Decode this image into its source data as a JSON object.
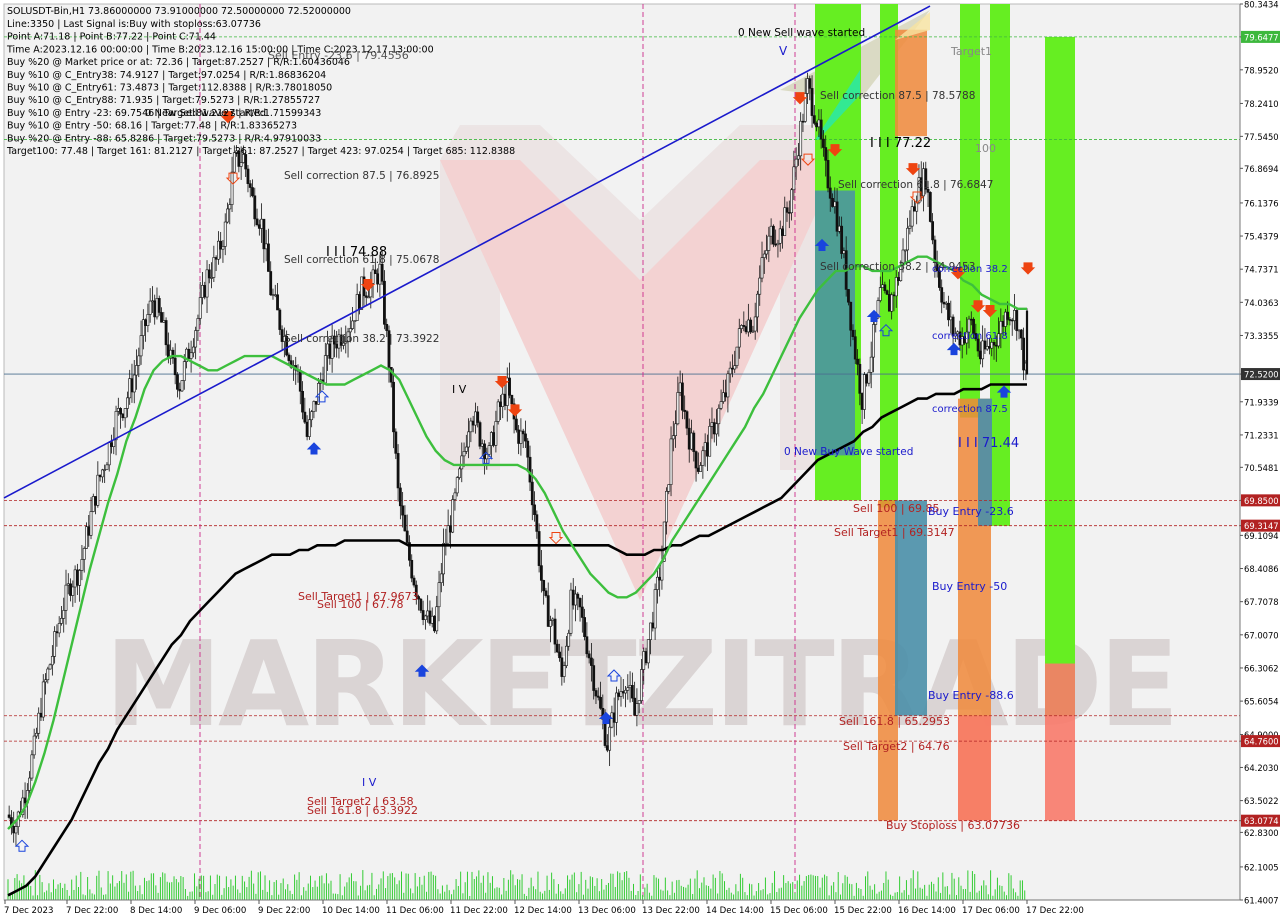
{
  "header": {
    "symbol_line": "SOLUSDT-Bin,H1  73.86000000 73.91000000 72.50000000 72.52000000",
    "lines": [
      "Line:3350 | Last Signal is:Buy with stoploss:63.07736",
      "Point A:71.18 | Point B:77.22 | Point C:71.44",
      "Time A:2023.12.16 00:00:00 | Time B:2023.12.16 15:00:00 | Time C:2023.12.17 13:00:00",
      "Buy %20 @ Market price or at: 72.36 | Target:87.2527 | R/R:1.60436046",
      "Buy %10 @ C_Entry38: 74.9127 | Target:97.0254 | R/R:1.86836204",
      "Buy %10 @ C_Entry61: 73.4873 | Target:112.8388 | R/R:3.78018050",
      "Buy %10 @ C_Entry88: 71.935 | Target:79.5273 | R/R:1.27855727",
      "Buy %10 @ Entry -23: 69.7546 | Target:81.2127 | R/R:1.71599343",
      "Buy %10 @ Entry -50: 68.16 | Target:77.48 | R/R:1.83365273",
      "Buy %20 @ Entry -88: 65.8286 | Target:79.5273 | R/R:4.97910033",
      "Target100: 77.48 | Target 161: 81.2127 | Target 261: 87.2527 | Target 423: 97.0254 | Target 685: 112.8388"
    ]
  },
  "watermark": "MARKETZITRADE",
  "colors": {
    "bull": "#1a1a1a",
    "bear": "#1a1a1a",
    "ma_fast": "#3dbf3d",
    "ma_slow": "#000000",
    "trendline": "#1a1acc",
    "green_level": "#3db83d",
    "red_level": "#b22222",
    "current_price_line": "#4a6f8f",
    "zone_green": "#66ee22",
    "zone_orange": "#f0883a",
    "zone_blue": "#4a8fa8",
    "zone_salmon": "#f87a6a"
  },
  "chart_data": {
    "type": "candlestick",
    "symbol": "SOLUSDT-Bin",
    "timeframe": "H1",
    "ylim": [
      61.4007,
      80.3434
    ],
    "y_ticks": [
      "80.3434",
      "79.6477",
      "78.9520",
      "78.2410",
      "77.5450",
      "76.8694",
      "76.1376",
      "75.4379",
      "74.7371",
      "74.0363",
      "73.3355",
      "72.5200",
      "71.9339",
      "71.2331",
      "70.5481",
      "69.8500",
      "69.3147",
      "69.1094",
      "68.4086",
      "67.7078",
      "67.0070",
      "66.3062",
      "65.6054",
      "64.9000",
      "64.7600",
      "64.2030",
      "63.5022",
      "63.0774",
      "62.8300",
      "62.1005",
      "61.4007"
    ],
    "y_ticks_highlighted": [
      {
        "value": "79.6477",
        "kind": "green"
      },
      {
        "value": "77.4800",
        "kind": "green"
      },
      {
        "value": "72.5200",
        "kind": "current"
      },
      {
        "value": "69.8500",
        "kind": "red"
      },
      {
        "value": "69.3147",
        "kind": "red"
      },
      {
        "value": "65.2953",
        "kind": "red"
      },
      {
        "value": "64.7600",
        "kind": "red"
      },
      {
        "value": "63.0774",
        "kind": "red"
      }
    ],
    "x_tick_labels": [
      "7 Dec 2023",
      "7 Dec 22:00",
      "8 Dec 14:00",
      "9 Dec 06:00",
      "9 Dec 22:00",
      "10 Dec 14:00",
      "11 Dec 06:00",
      "11 Dec 22:00",
      "12 Dec 14:00",
      "13 Dec 06:00",
      "13 Dec 22:00",
      "14 Dec 14:00",
      "15 Dec 06:00",
      "15 Dec 22:00",
      "16 Dec 14:00",
      "17 Dec 06:00",
      "17 Dec 22:00"
    ],
    "current_price": 72.52,
    "last_bar": {
      "open": 73.86,
      "high": 73.91,
      "low": 72.5,
      "close": 72.52
    },
    "anchor_closes": [
      63.2,
      63.0,
      63.7,
      64.6,
      65.8,
      66.6,
      67.5,
      68.1,
      68.4,
      69.3,
      70.2,
      70.8,
      71.6,
      71.9,
      72.5,
      73.4,
      74.1,
      73.6,
      72.8,
      72.3,
      73.0,
      73.7,
      74.6,
      74.9,
      75.6,
      77.0,
      77.1,
      76.2,
      75.7,
      74.3,
      73.6,
      73.0,
      72.5,
      71.2,
      72.0,
      72.8,
      73.2,
      73.4,
      73.7,
      74.3,
      74.4,
      74.7,
      72.8,
      70.0,
      68.8,
      68.0,
      67.4,
      67.1,
      68.8,
      69.6,
      70.6,
      71.8,
      71.2,
      70.8,
      71.7,
      72.2,
      71.3,
      71.1,
      69.6,
      67.7,
      67.2,
      66.1,
      67.7,
      67.5,
      66.6,
      65.6,
      64.7,
      65.6,
      66.1,
      65.3,
      66.4,
      67.4,
      68.6,
      71.0,
      72.2,
      71.2,
      70.6,
      71.0,
      71.6,
      72.1,
      72.9,
      73.7,
      73.6,
      74.8,
      75.5,
      75.5,
      76.1,
      77.4,
      78.6,
      77.9,
      76.8,
      76.1,
      74.9,
      73.3,
      72.0,
      73.0,
      74.2,
      74.0,
      74.6,
      75.5,
      76.4,
      76.7,
      75.0,
      74.0,
      73.4,
      73.3,
      73.6,
      72.9,
      73.1,
      73.4,
      73.9,
      73.7,
      72.52
    ],
    "ma_fast": [
      62.9,
      63.1,
      63.4,
      63.9,
      64.5,
      65.2,
      66.0,
      66.8,
      67.6,
      68.4,
      69.1,
      69.8,
      70.4,
      71.1,
      71.6,
      72.2,
      72.6,
      72.8,
      72.9,
      72.9,
      72.8,
      72.7,
      72.6,
      72.6,
      72.7,
      72.8,
      72.9,
      72.9,
      72.9,
      72.9,
      72.8,
      72.7,
      72.6,
      72.5,
      72.4,
      72.3,
      72.3,
      72.3,
      72.4,
      72.5,
      72.6,
      72.7,
      72.6,
      72.4,
      72.0,
      71.6,
      71.2,
      70.9,
      70.7,
      70.6,
      70.6,
      70.6,
      70.6,
      70.6,
      70.6,
      70.6,
      70.6,
      70.5,
      70.3,
      70.0,
      69.6,
      69.2,
      68.9,
      68.6,
      68.3,
      68.1,
      67.9,
      67.8,
      67.8,
      67.9,
      68.1,
      68.3,
      68.6,
      69.0,
      69.3,
      69.6,
      69.9,
      70.2,
      70.5,
      70.8,
      71.1,
      71.4,
      71.8,
      72.1,
      72.5,
      72.9,
      73.3,
      73.7,
      74.0,
      74.3,
      74.5,
      74.7,
      74.7,
      74.8,
      74.8,
      74.7,
      74.7,
      74.7,
      74.8,
      74.9,
      75.0,
      75.0,
      74.9,
      74.8,
      74.7,
      74.5,
      74.4,
      74.2,
      74.1,
      74.0,
      74.0,
      73.9,
      73.9
    ],
    "ma_slow": [
      61.5,
      61.6,
      61.7,
      61.9,
      62.2,
      62.5,
      62.8,
      63.1,
      63.5,
      63.9,
      64.3,
      64.6,
      65.0,
      65.3,
      65.6,
      65.9,
      66.2,
      66.5,
      66.8,
      67.0,
      67.3,
      67.5,
      67.7,
      67.9,
      68.1,
      68.3,
      68.4,
      68.5,
      68.6,
      68.7,
      68.7,
      68.7,
      68.8,
      68.8,
      68.9,
      68.9,
      68.9,
      69.0,
      69.0,
      69.0,
      69.0,
      69.0,
      69.0,
      69.0,
      68.9,
      68.9,
      68.9,
      68.9,
      68.9,
      68.9,
      68.9,
      68.9,
      68.9,
      68.9,
      68.9,
      68.9,
      68.9,
      68.9,
      68.9,
      68.9,
      68.9,
      68.9,
      68.9,
      68.9,
      68.9,
      68.9,
      68.9,
      68.8,
      68.7,
      68.7,
      68.7,
      68.8,
      68.8,
      68.9,
      68.9,
      69.0,
      69.1,
      69.1,
      69.2,
      69.3,
      69.4,
      69.5,
      69.6,
      69.7,
      69.8,
      69.9,
      70.1,
      70.3,
      70.5,
      70.7,
      70.8,
      70.9,
      71.0,
      71.1,
      71.3,
      71.4,
      71.6,
      71.7,
      71.8,
      71.9,
      72.0,
      72.0,
      72.1,
      72.1,
      72.1,
      72.2,
      72.2,
      72.2,
      72.3,
      72.3,
      72.3,
      72.3,
      72.3
    ],
    "horizontal_levels": [
      {
        "price": 79.6477,
        "kind": "green"
      },
      {
        "price": 77.48,
        "kind": "green"
      },
      {
        "price": 72.52,
        "kind": "current"
      },
      {
        "price": 69.85,
        "kind": "red"
      },
      {
        "price": 69.3147,
        "kind": "red"
      },
      {
        "price": 65.2953,
        "kind": "red"
      },
      {
        "price": 64.76,
        "kind": "red"
      },
      {
        "price": 63.0774,
        "kind": "red"
      }
    ],
    "annotations": [
      {
        "text": "Sell Entry -23.6 | 79.4556",
        "color": "#555555"
      },
      {
        "text": "0 New Sell wave started",
        "color": "#000000"
      },
      {
        "text": "0 New Sell wave started",
        "color": "#000000"
      },
      {
        "text": "Sell correction 87.5 | 76.8925",
        "color": "#333333"
      },
      {
        "text": "I I I 74.88",
        "color": "#000000"
      },
      {
        "text": "Sell correction 61.8 | 75.0678",
        "color": "#333333"
      },
      {
        "text": "Sell correction 38.2 | 73.3922",
        "color": "#333333"
      },
      {
        "text": "I V",
        "color": "#000000"
      },
      {
        "text": "Sell Target1 | 67.9673",
        "color": "#b22222"
      },
      {
        "text": "Sell 100 | 67.78",
        "color": "#b22222"
      },
      {
        "text": "I V",
        "color": "#1a1acc"
      },
      {
        "text": "Sell Target2 | 63.58",
        "color": "#b22222"
      },
      {
        "text": "Sell 161.8 | 63.3922",
        "color": "#b22222"
      },
      {
        "text": "Sell correction 87.5 | 78.5788",
        "color": "#333333"
      },
      {
        "text": "I I I 77.22",
        "color": "#000000"
      },
      {
        "text": "Sell correction 61.8 | 76.6847",
        "color": "#333333"
      },
      {
        "text": "Sell correction 38.2 | 74.9453",
        "color": "#333333"
      },
      {
        "text": "correction 38.2",
        "color": "#1a1acc"
      },
      {
        "text": "correction 61.8",
        "color": "#1a1acc"
      },
      {
        "text": "correction 87.5",
        "color": "#1a1acc"
      },
      {
        "text": "I I I 71.44",
        "color": "#1a1acc"
      },
      {
        "text": "0 New Buy Wave started",
        "color": "#1a1acc"
      },
      {
        "text": "Sell 100 | 69.85",
        "color": "#b22222"
      },
      {
        "text": "Sell Target1 | 69.3147",
        "color": "#b22222"
      },
      {
        "text": "Buy Entry -23.6",
        "color": "#1a1acc"
      },
      {
        "text": "Buy Entry -50",
        "color": "#1a1acc"
      },
      {
        "text": "Buy Entry -88.6",
        "color": "#1a1acc"
      },
      {
        "text": "Sell 161.8 | 65.2953",
        "color": "#b22222"
      },
      {
        "text": "Sell Target2 | 64.76",
        "color": "#b22222"
      },
      {
        "text": "Buy Stoploss | 63.07736",
        "color": "#b22222"
      },
      {
        "text": "Target1",
        "color": "#888888"
      },
      {
        "text": "100",
        "color": "#888888"
      }
    ],
    "grid": false
  }
}
